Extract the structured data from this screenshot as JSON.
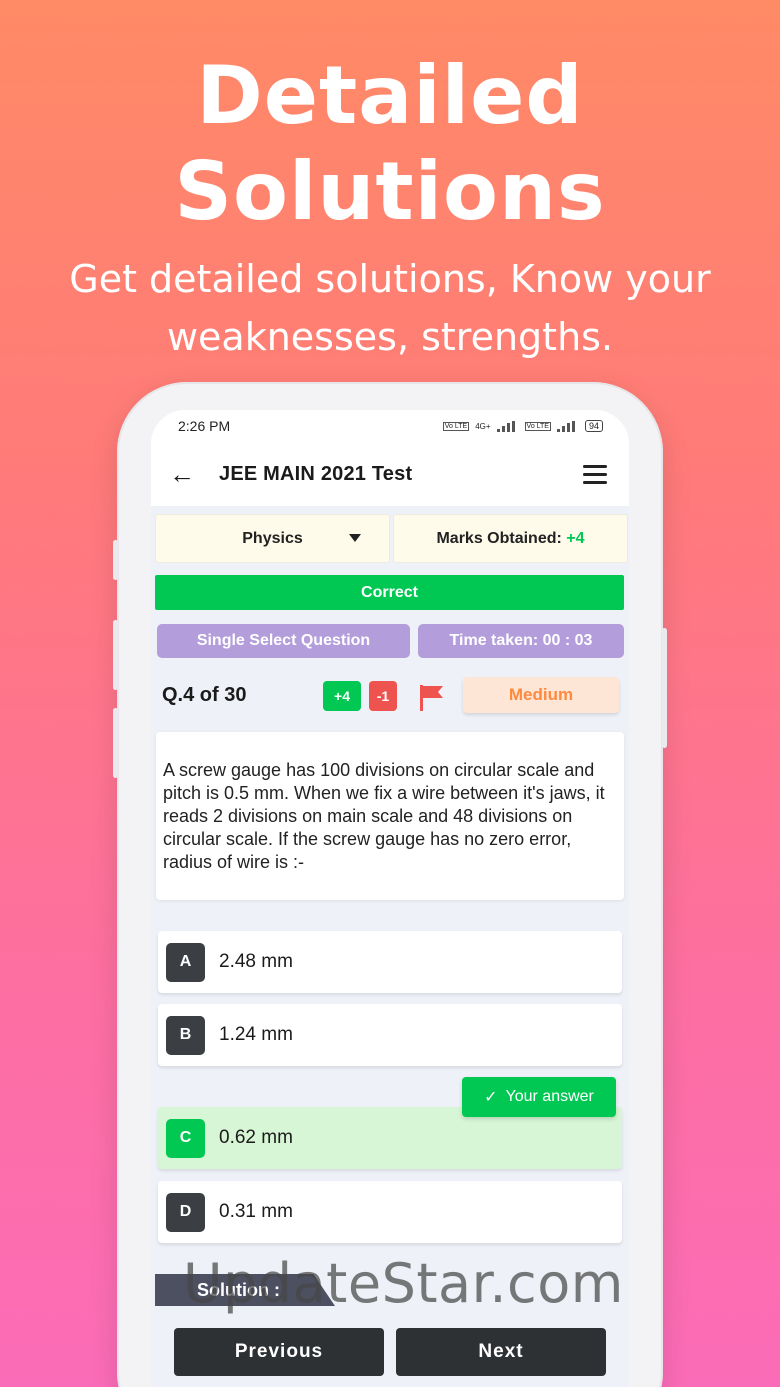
{
  "promo": {
    "title_line1": "Detailed",
    "title_line2": "Solutions",
    "subtitle_line1": "Get detailed solutions, Know your",
    "subtitle_line2": "weaknesses, strengths."
  },
  "status_bar": {
    "time": "2:26 PM",
    "net1": "Vo LTE",
    "net2": "4G+",
    "net3": "Vo LTE",
    "battery": "94"
  },
  "app_bar": {
    "title": "JEE MAIN 2021 Test"
  },
  "subject": {
    "selected": "Physics"
  },
  "marks": {
    "label": "Marks Obtained:",
    "value": "+4"
  },
  "result": {
    "status": "Correct"
  },
  "question_meta": {
    "type": "Single Select Question",
    "time_taken": "Time taken: 00 : 03",
    "number": "Q.4 of 30",
    "positive_marks": "+4",
    "negative_marks": "-1",
    "difficulty": "Medium"
  },
  "question": {
    "text": "A screw gauge has 100 divisions on circular scale and pitch is 0.5 mm. When we fix a wire between it's jaws, it reads 2 divisions on main scale and 48 divisions on circular scale. If the screw gauge has no zero error, radius of wire is :-"
  },
  "options": [
    {
      "letter": "A",
      "text": "2.48 mm"
    },
    {
      "letter": "B",
      "text": "1.24 mm"
    },
    {
      "letter": "C",
      "text": "0.62 mm"
    },
    {
      "letter": "D",
      "text": "0.31 mm"
    }
  ],
  "your_answer": {
    "check": "✓",
    "label": "Your answer"
  },
  "solution": {
    "label": "Solution :"
  },
  "navigation": {
    "previous": "Previous",
    "next": "Next"
  },
  "watermark": {
    "text": "UpdateStar.com"
  },
  "colors": {
    "correct": "#00c853",
    "accent_purple": "#b39ddb",
    "difficulty": "#ff8a3d",
    "negative": "#ef5350"
  }
}
